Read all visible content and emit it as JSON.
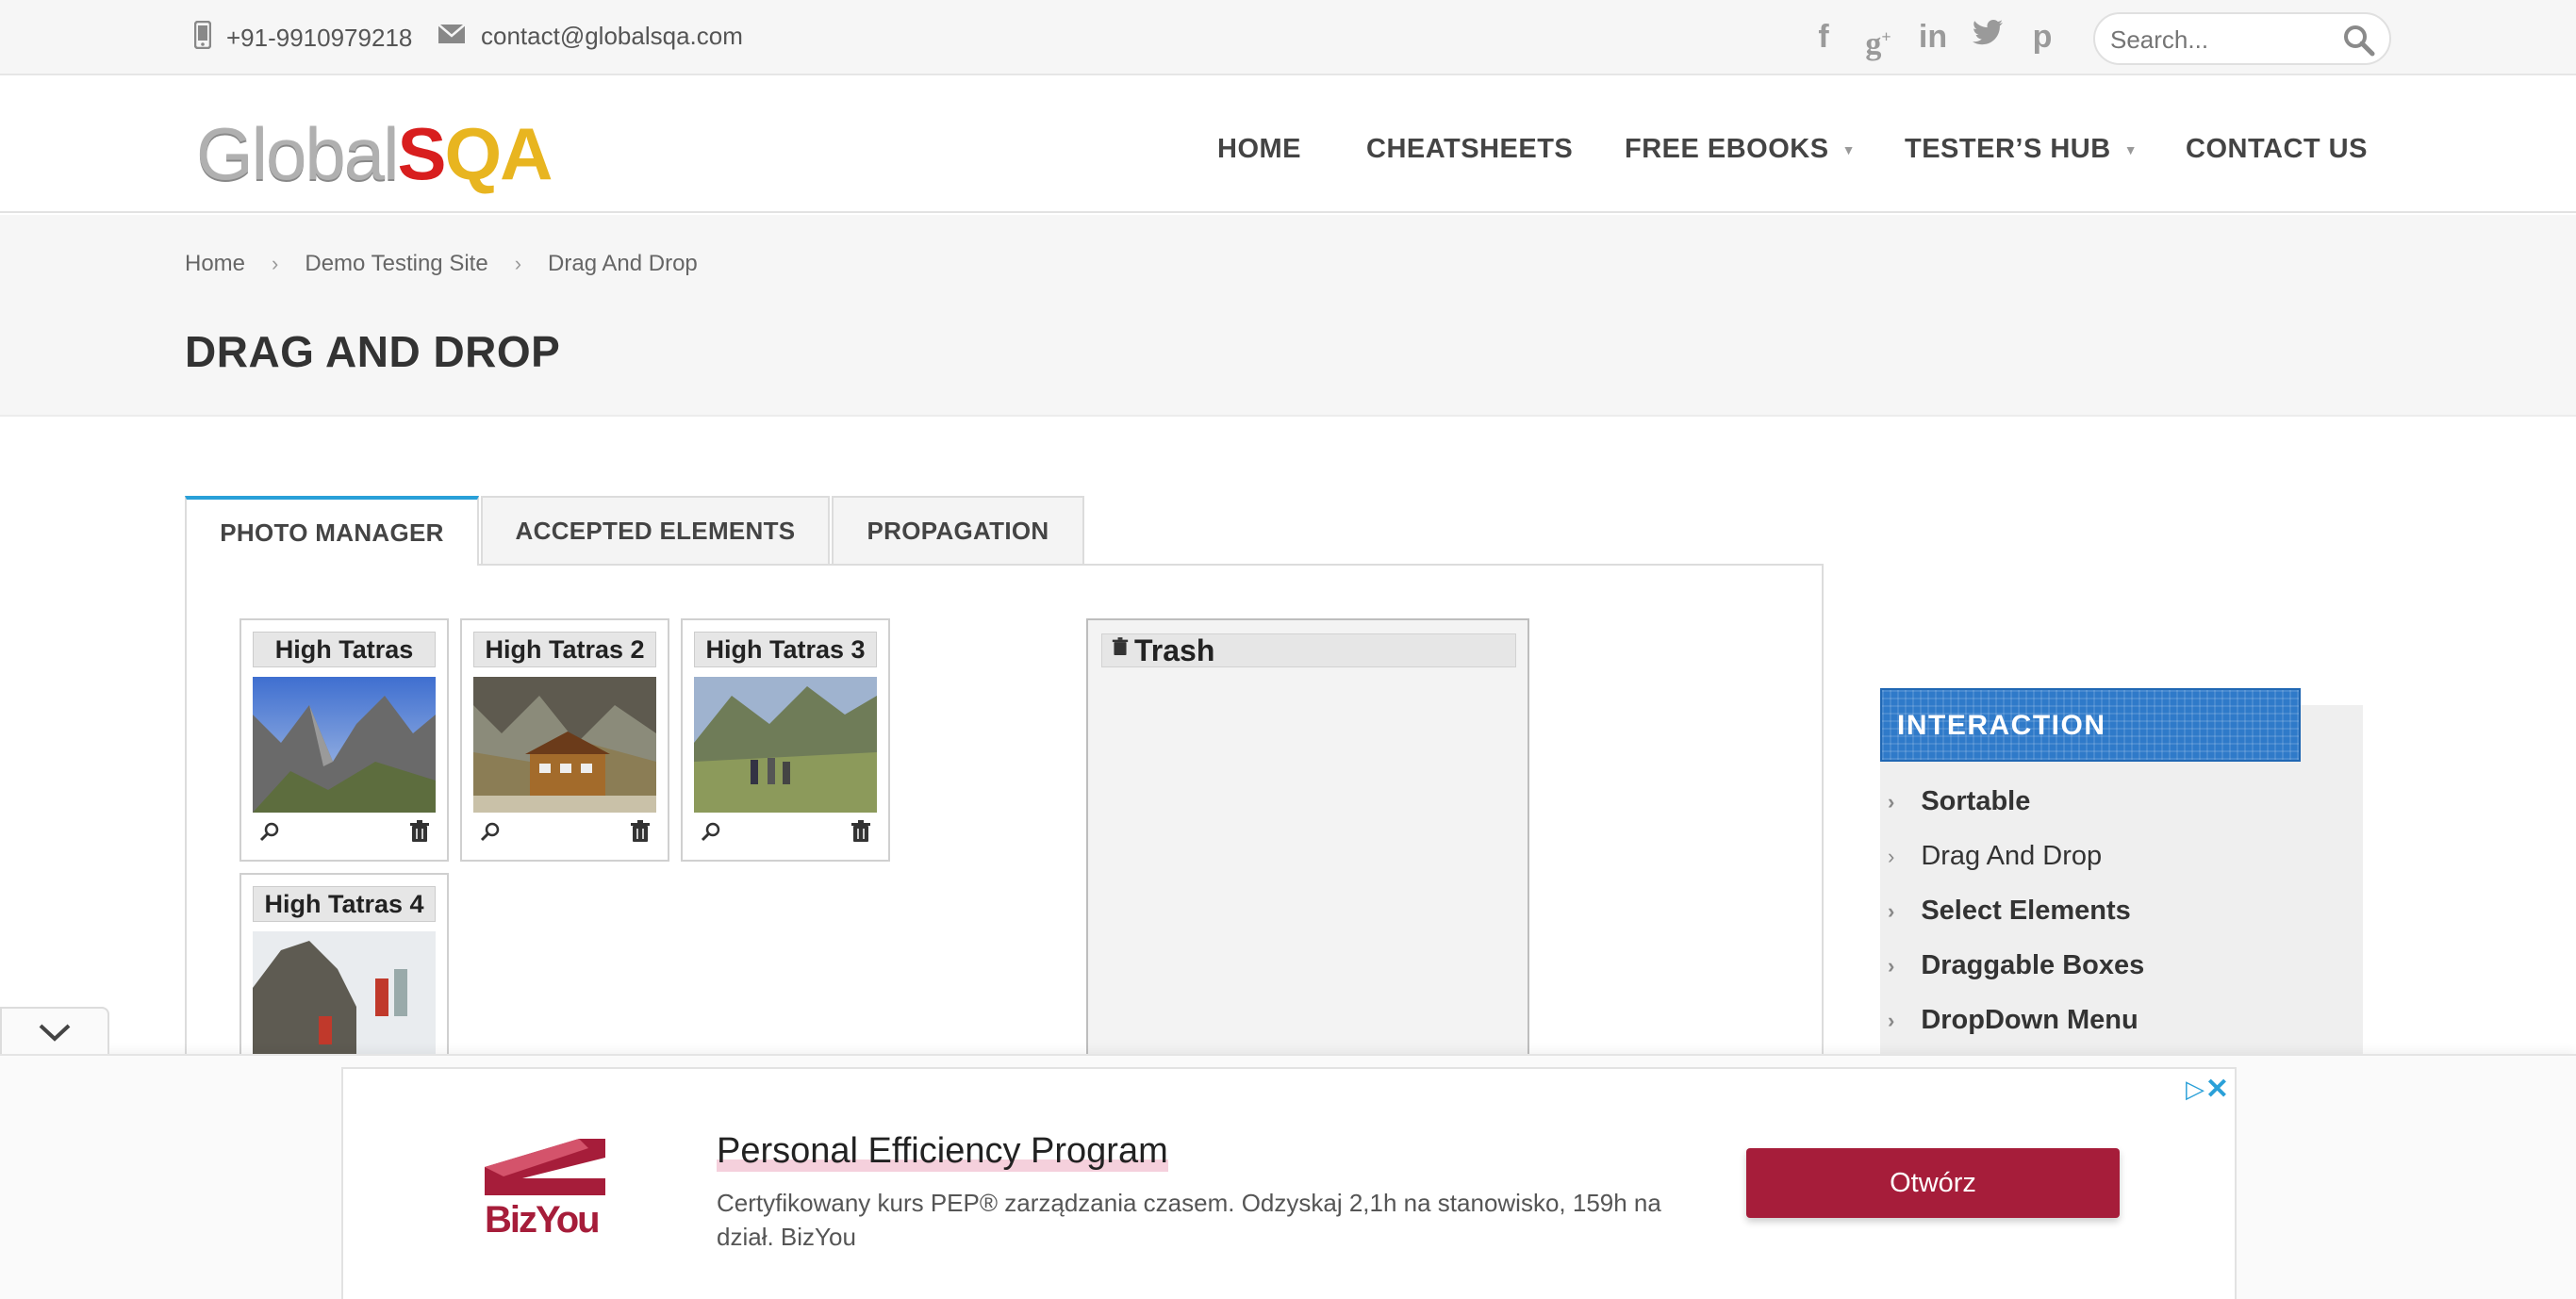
{
  "topbar": {
    "phone": "+91-9910979218",
    "email": "contact@globalsqa.com",
    "social": [
      "facebook-icon",
      "google-plus-icon",
      "linkedin-icon",
      "twitter-icon",
      "pinterest-icon"
    ],
    "search_placeholder": "Search..."
  },
  "header": {
    "logo_left": "Global",
    "logo_s": "S",
    "logo_qa": "QA",
    "nav": {
      "home": "HOME",
      "cheatsheets": "CHEATSHEETS",
      "free_ebooks": "FREE EBOOKS",
      "testers_hub": "TESTER’S HUB",
      "contact": "CONTACT US"
    }
  },
  "breadcrumb": {
    "home": "Home",
    "demo": "Demo Testing Site",
    "current": "Drag And Drop"
  },
  "page_title": "DRAG AND DROP",
  "tabs": {
    "photo_manager": "PHOTO MANAGER",
    "accepted_elements": "ACCEPTED ELEMENTS",
    "propagation": "PROPAGATION"
  },
  "gallery": {
    "item1": "High Tatras",
    "item2": "High Tatras 2",
    "item3": "High Tatras 3",
    "item4": "High Tatras 4"
  },
  "trash": {
    "title": "Trash"
  },
  "sidebar": {
    "title": "INTERACTION",
    "items": {
      "sortable": "Sortable",
      "drag_and_drop": "Drag And Drop",
      "select_elements": "Select Elements",
      "draggable_boxes": "Draggable Boxes",
      "dropdown_menu": "DropDown Menu"
    }
  },
  "ad": {
    "brand": "BizYou",
    "title": "Personal Efficiency Program",
    "description": "Certyfikowany kurs PEP® zarządzania czasem. Odzyskaj 2,1h na stanowisko, 159h na dział. BizYou",
    "button": "Otwórz"
  },
  "colors": {
    "accent_blue": "#29a0d8",
    "widget_blue": "#2f7ac9",
    "ad_red": "#a61d3a"
  }
}
